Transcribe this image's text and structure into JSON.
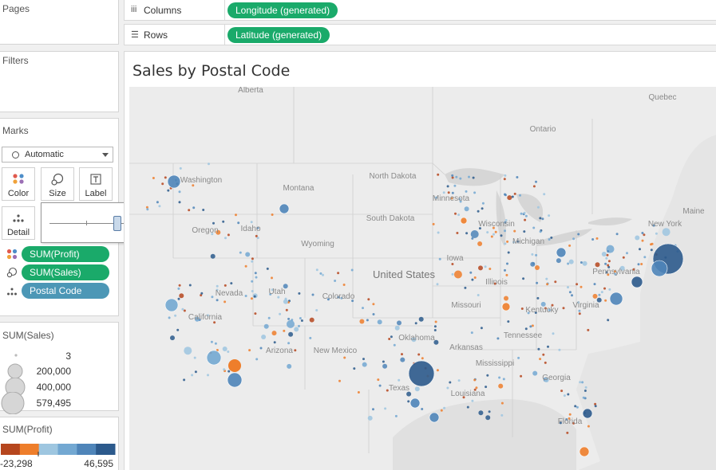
{
  "panes": {
    "pages_title": "Pages",
    "filters_title": "Filters",
    "marks_title": "Marks"
  },
  "shelves": {
    "columns_label": "Columns",
    "columns_pill": "Longitude (generated)",
    "rows_label": "Rows",
    "rows_pill": "Latitude (generated)"
  },
  "marks": {
    "mark_type": "Automatic",
    "buttons": {
      "color": "Color",
      "size": "Size",
      "label": "Label",
      "detail": "Detail"
    },
    "pills": {
      "profit": "SUM(Profit)",
      "sales": "SUM(Sales)",
      "postal": "Postal Code"
    }
  },
  "size_slider": {
    "level": 0.48
  },
  "sales_legend": {
    "title": "SUM(Sales)",
    "entries": [
      "3",
      "200,000",
      "400,000",
      "579,495"
    ]
  },
  "profit_legend": {
    "title": "SUM(Profit)",
    "min": "-23,298",
    "max": "46,595",
    "colors": [
      "#b6461e",
      "#ee7e2b",
      "#9ec6e0",
      "#73a8d2",
      "#4f85b9",
      "#2c5a8c"
    ]
  },
  "sheet": {
    "title": "Sales by Postal Code"
  },
  "map": {
    "labels": [
      "Alberta",
      "Quebec",
      "Ontario",
      "Washington",
      "North Dakota",
      "Montana",
      "Minnesota",
      "Maine",
      "Wisconsin",
      "New York",
      "South Dakota",
      "Idaho",
      "Oregon",
      "Wyoming",
      "Iowa",
      "Michigan",
      "Pennsylvania",
      "United States",
      "Illinois",
      "Nevada",
      "Utah",
      "Colorado",
      "Missouri",
      "Kentucky",
      "Virginia",
      "California",
      "Oklahoma",
      "Arkansas",
      "Tennessee",
      "Arizona",
      "New Mexico",
      "Mississippi",
      "Georgia",
      "Texas",
      "Louisiana",
      "Florida"
    ]
  }
}
